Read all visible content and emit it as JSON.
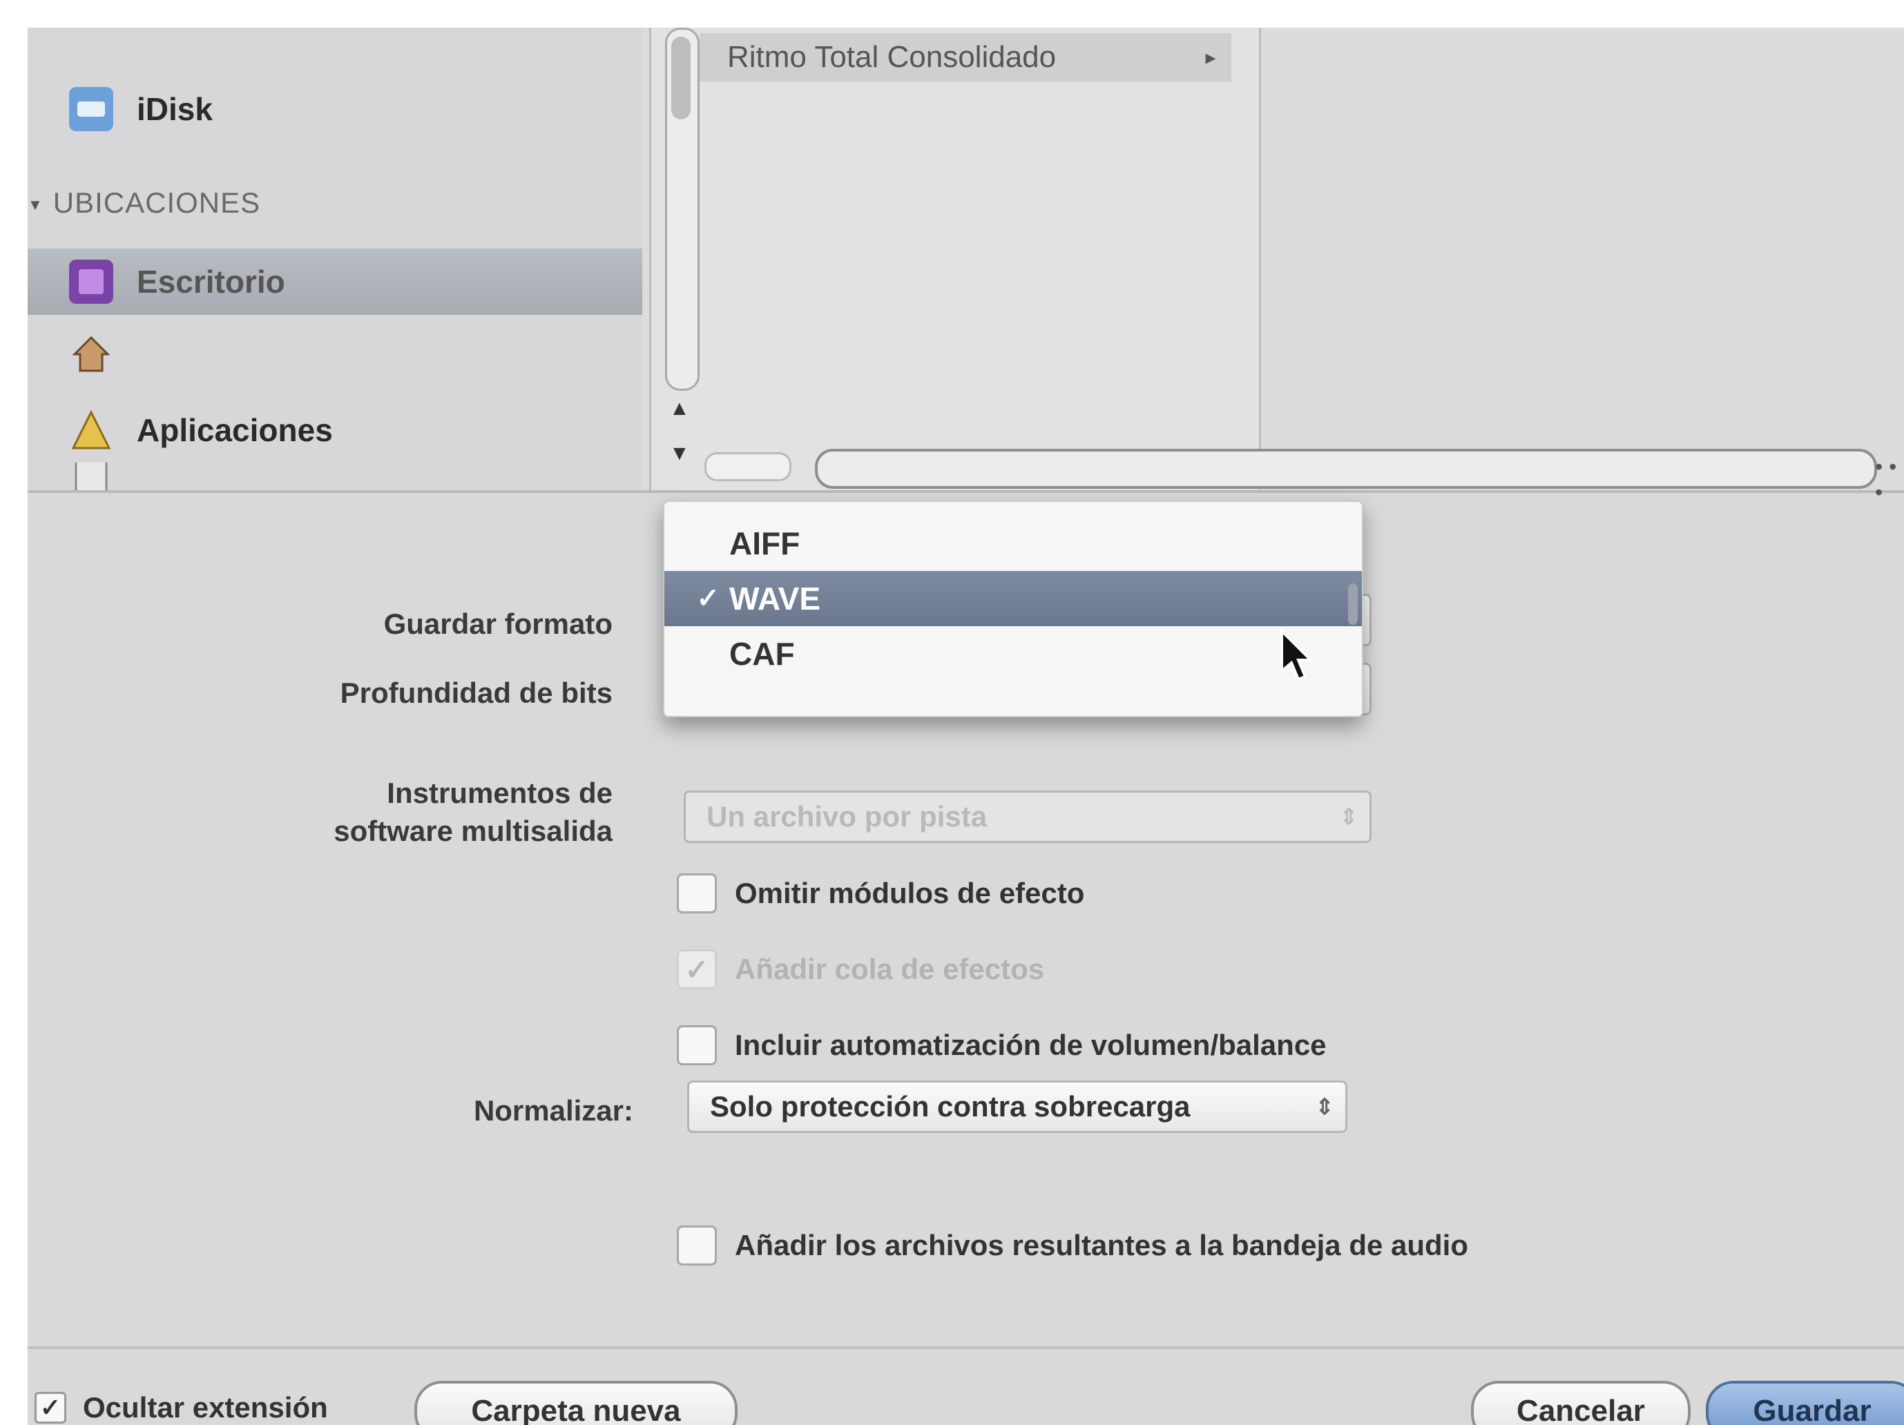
{
  "sidebar": {
    "items": [
      {
        "label": "iDisk",
        "icon": "idisk-icon"
      },
      {
        "label": "Escritorio",
        "icon": "desktop-icon",
        "selected": true
      },
      {
        "label": "",
        "icon": "home-icon"
      },
      {
        "label": "Aplicaciones",
        "icon": "applications-icon"
      },
      {
        "label": "",
        "icon": "documents-icon"
      }
    ],
    "section_header": "UBICACIONES",
    "section_tri": "▼"
  },
  "file_list": {
    "item": "Ritmo Total Consolidado",
    "arrow": "▸"
  },
  "options": {
    "format_label": "Guardar formato",
    "bitdepth_label": "Profundidad de bits",
    "software_label_1": "Instrumentos de",
    "software_label_2": "software multisalida",
    "software_value": "Un archivo por pista",
    "bypass_label": "Omitir módulos de efecto",
    "effects_tail_label": "Añadir cola de efectos",
    "automation_label": "Incluir automatización de volumen/balance",
    "normalize_label": "Normalizar:",
    "normalize_value": "Solo protección contra sobrecarga",
    "add_to_bin_label": "Añadir los archivos resultantes a la bandeja de audio",
    "stepper_glyph": "⇕",
    "checkmark": "✓"
  },
  "format_menu": {
    "items": [
      {
        "label": "AIFF",
        "selected": false
      },
      {
        "label": "WAVE",
        "selected": true
      },
      {
        "label": "CAF",
        "selected": false
      }
    ]
  },
  "footer": {
    "hide_extension_label": "Ocultar extensión",
    "new_folder": "Carpeta nueva",
    "cancel": "Cancelar",
    "save": "Guardar"
  },
  "colors": {
    "accent_selected": "#6a778c",
    "default_button": "#6f97cf"
  }
}
